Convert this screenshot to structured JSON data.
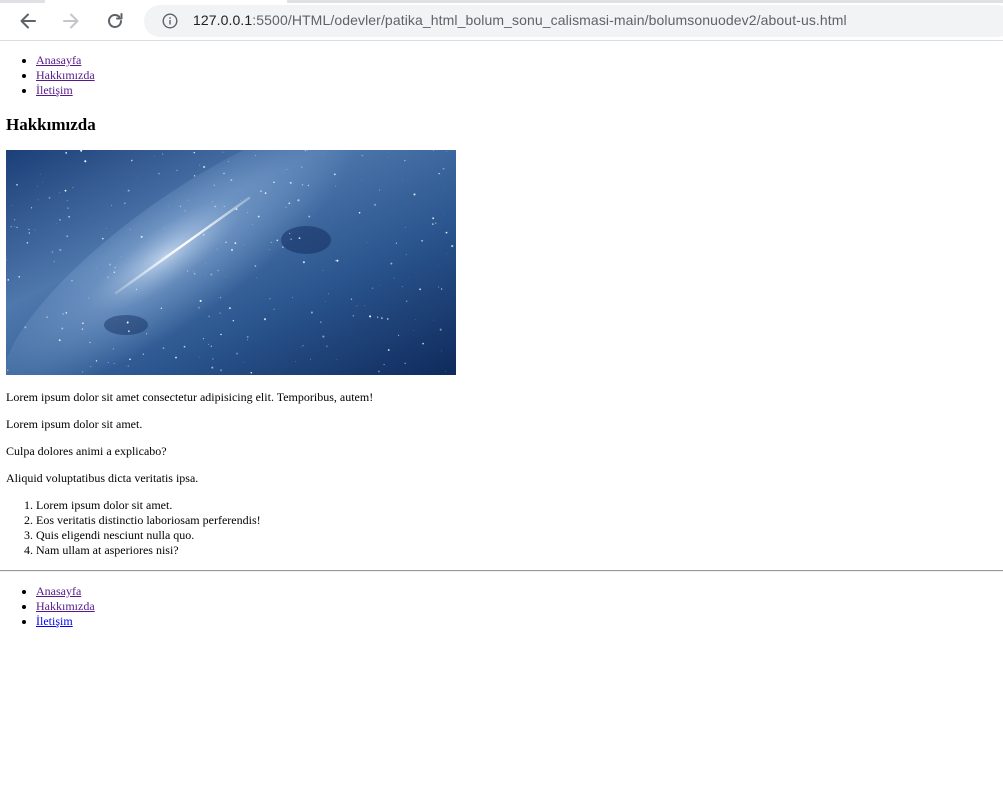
{
  "browser": {
    "url_host": "127.0.0.1",
    "url_rest": ":5500/HTML/odevler/patika_html_bolum_sonu_calismasi-main/bolumsonuodev2/about-us.html",
    "icons": [
      "back-arrow-icon",
      "forward-arrow-icon",
      "reload-icon",
      "info-icon"
    ]
  },
  "nav": {
    "items": [
      {
        "label": "Anasayfa"
      },
      {
        "label": "Hakkımızda"
      },
      {
        "label": "İletişim"
      }
    ]
  },
  "main": {
    "title": "Hakkımızda",
    "paragraphs": [
      "Lorem ipsum dolor sit amet consectetur adipisicing elit. Temporibus, autem!",
      "Lorem ipsum dolor sit amet.",
      "Culpa dolores animi a explicabo?",
      "Aliquid voluptatibus dicta veritatis ipsa."
    ],
    "list": [
      "Lorem ipsum dolor sit amet.",
      "Eos veritatis distinctio laboriosam perferendis!",
      "Quis eligendi nesciunt nulla quo.",
      "Nam ullam at asperiores nisi?"
    ]
  },
  "footer_nav": {
    "items": [
      {
        "label": "Anasayfa"
      },
      {
        "label": "Hakkımızda"
      },
      {
        "label": "İletişim"
      }
    ]
  },
  "colors": {
    "link_visited": "#551a8b",
    "link_unvisited": "#0000ee",
    "sky_dark": "#0f2a5c",
    "sky_light": "#6f9ccc"
  }
}
